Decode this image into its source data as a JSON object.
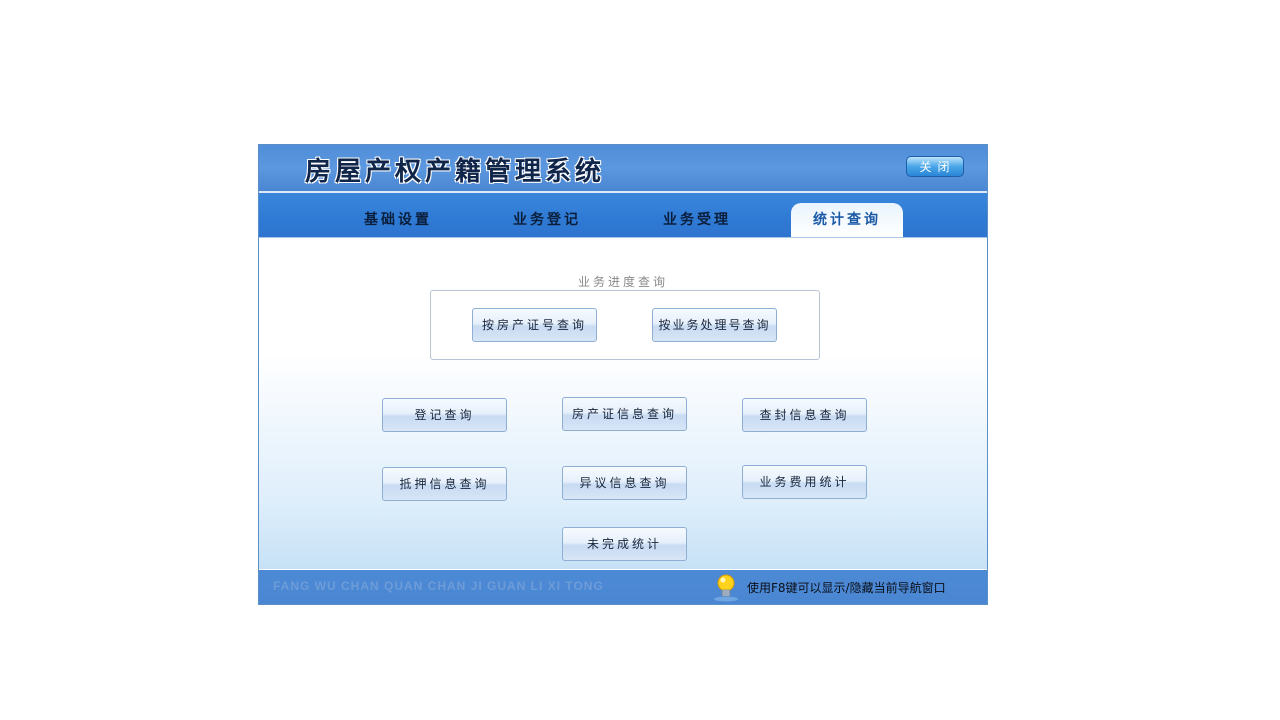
{
  "app": {
    "title": "房屋产权产籍管理系统",
    "close_label": "关闭"
  },
  "tabs": [
    {
      "label": "基础设置",
      "active": false
    },
    {
      "label": "业务登记",
      "active": false
    },
    {
      "label": "业务受理",
      "active": false
    },
    {
      "label": "统计查询",
      "active": true
    }
  ],
  "progress_group": {
    "label": "业务进度查询",
    "buttons": [
      "按房产证号查询",
      "按业务处理号查询"
    ]
  },
  "query_buttons": [
    "登记查询",
    "房产证信息查询",
    "查封信息查询",
    "抵押信息查询",
    "异议信息查询",
    "业务费用统计",
    "未完成统计"
  ],
  "footer": {
    "pinyin": "FANG WU CHAN QUAN CHAN JI GUAN LI XI TONG",
    "hint": "使用F8键可以显示/隐藏当前导航窗口",
    "bulb_icon": "lightbulb-icon"
  },
  "colors": {
    "title_bar": "#4f8dd8",
    "tab_bar": "#2f7ad4",
    "status_bar": "#4a86d2",
    "active_tab_text": "#1b5aa6"
  }
}
